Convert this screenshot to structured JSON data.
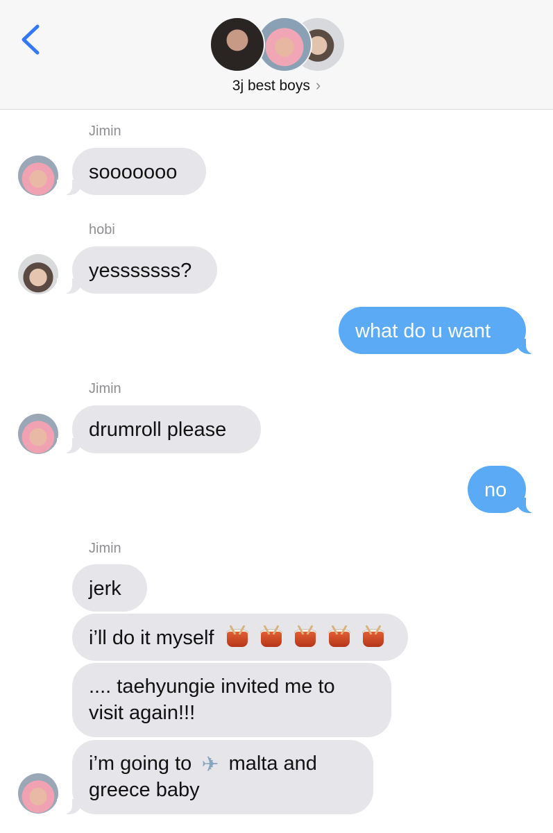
{
  "header": {
    "title": "3j best boys",
    "back_icon": "chevron-left-icon",
    "title_chevron": "chevron-right-icon",
    "colors": {
      "accent": "#3478f6",
      "header_bg": "#f7f7f8"
    }
  },
  "messages": {
    "m1": {
      "sender": "Jimin",
      "text": "sooooooo"
    },
    "m2": {
      "sender": "hobi",
      "text": "yesssssss?"
    },
    "m3": {
      "text": "what do u want"
    },
    "m4": {
      "sender": "Jimin",
      "text": "drumroll please"
    },
    "m5": {
      "text": "no"
    },
    "m6": {
      "sender": "Jimin",
      "text": "jerk"
    },
    "m7": {
      "text": "i’ll do it myself",
      "emoji": "drum-icon",
      "emoji_count": 5
    },
    "m8": {
      "line1": ".... taehyungie invited me to",
      "line2": "visit again!!!"
    },
    "m9": {
      "part1": "i’m going to",
      "emoji": "airplane-icon",
      "part2": "malta and",
      "line2": "greece baby"
    }
  },
  "colors": {
    "incoming_bubble": "#e5e5ea",
    "outgoing_bubble": "#5aaaf5",
    "sender_label": "#8e8e93"
  }
}
